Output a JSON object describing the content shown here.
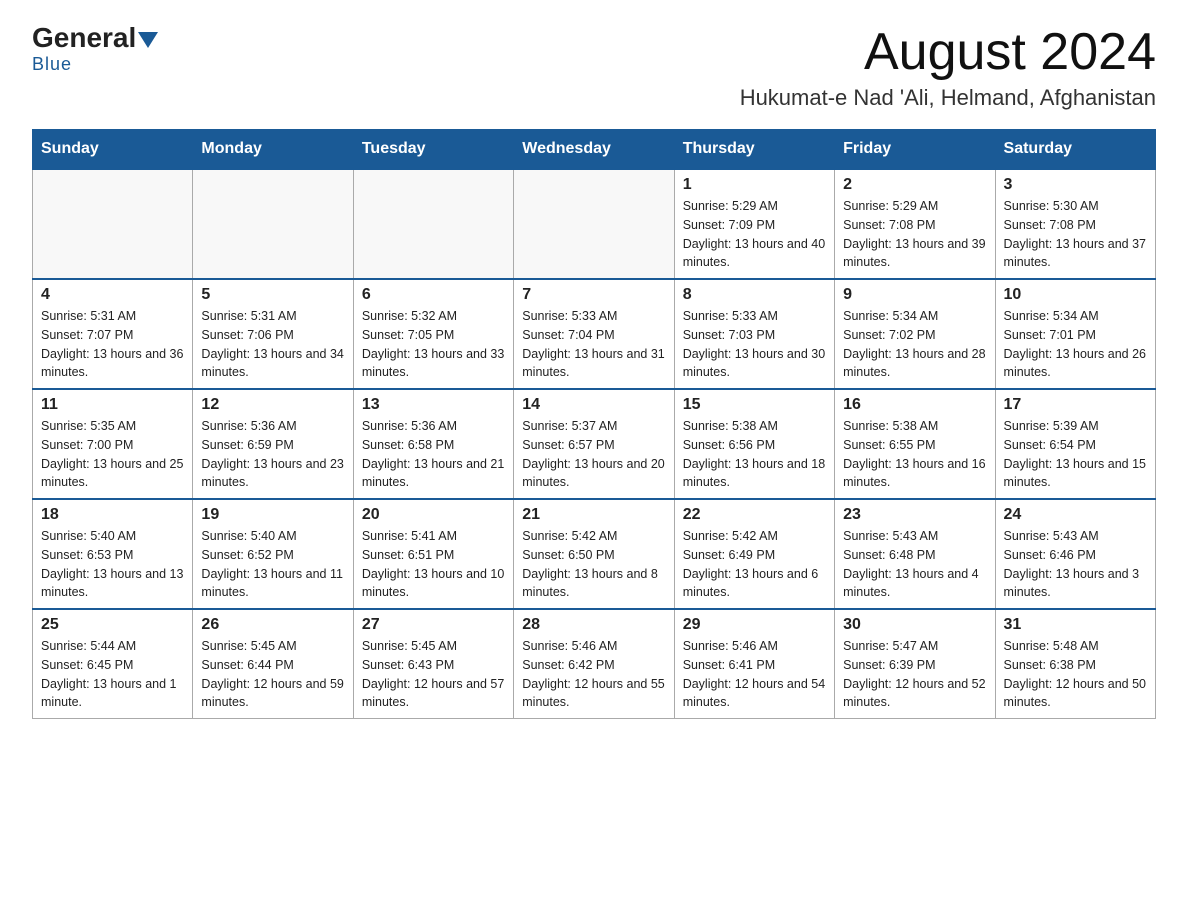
{
  "logo": {
    "general": "General",
    "blue": "Blue"
  },
  "title": "August 2024",
  "subtitle": "Hukumat-e Nad 'Ali, Helmand, Afghanistan",
  "days_of_week": [
    "Sunday",
    "Monday",
    "Tuesday",
    "Wednesday",
    "Thursday",
    "Friday",
    "Saturday"
  ],
  "weeks": [
    [
      {
        "num": "",
        "info": ""
      },
      {
        "num": "",
        "info": ""
      },
      {
        "num": "",
        "info": ""
      },
      {
        "num": "",
        "info": ""
      },
      {
        "num": "1",
        "info": "Sunrise: 5:29 AM\nSunset: 7:09 PM\nDaylight: 13 hours and 40 minutes."
      },
      {
        "num": "2",
        "info": "Sunrise: 5:29 AM\nSunset: 7:08 PM\nDaylight: 13 hours and 39 minutes."
      },
      {
        "num": "3",
        "info": "Sunrise: 5:30 AM\nSunset: 7:08 PM\nDaylight: 13 hours and 37 minutes."
      }
    ],
    [
      {
        "num": "4",
        "info": "Sunrise: 5:31 AM\nSunset: 7:07 PM\nDaylight: 13 hours and 36 minutes."
      },
      {
        "num": "5",
        "info": "Sunrise: 5:31 AM\nSunset: 7:06 PM\nDaylight: 13 hours and 34 minutes."
      },
      {
        "num": "6",
        "info": "Sunrise: 5:32 AM\nSunset: 7:05 PM\nDaylight: 13 hours and 33 minutes."
      },
      {
        "num": "7",
        "info": "Sunrise: 5:33 AM\nSunset: 7:04 PM\nDaylight: 13 hours and 31 minutes."
      },
      {
        "num": "8",
        "info": "Sunrise: 5:33 AM\nSunset: 7:03 PM\nDaylight: 13 hours and 30 minutes."
      },
      {
        "num": "9",
        "info": "Sunrise: 5:34 AM\nSunset: 7:02 PM\nDaylight: 13 hours and 28 minutes."
      },
      {
        "num": "10",
        "info": "Sunrise: 5:34 AM\nSunset: 7:01 PM\nDaylight: 13 hours and 26 minutes."
      }
    ],
    [
      {
        "num": "11",
        "info": "Sunrise: 5:35 AM\nSunset: 7:00 PM\nDaylight: 13 hours and 25 minutes."
      },
      {
        "num": "12",
        "info": "Sunrise: 5:36 AM\nSunset: 6:59 PM\nDaylight: 13 hours and 23 minutes."
      },
      {
        "num": "13",
        "info": "Sunrise: 5:36 AM\nSunset: 6:58 PM\nDaylight: 13 hours and 21 minutes."
      },
      {
        "num": "14",
        "info": "Sunrise: 5:37 AM\nSunset: 6:57 PM\nDaylight: 13 hours and 20 minutes."
      },
      {
        "num": "15",
        "info": "Sunrise: 5:38 AM\nSunset: 6:56 PM\nDaylight: 13 hours and 18 minutes."
      },
      {
        "num": "16",
        "info": "Sunrise: 5:38 AM\nSunset: 6:55 PM\nDaylight: 13 hours and 16 minutes."
      },
      {
        "num": "17",
        "info": "Sunrise: 5:39 AM\nSunset: 6:54 PM\nDaylight: 13 hours and 15 minutes."
      }
    ],
    [
      {
        "num": "18",
        "info": "Sunrise: 5:40 AM\nSunset: 6:53 PM\nDaylight: 13 hours and 13 minutes."
      },
      {
        "num": "19",
        "info": "Sunrise: 5:40 AM\nSunset: 6:52 PM\nDaylight: 13 hours and 11 minutes."
      },
      {
        "num": "20",
        "info": "Sunrise: 5:41 AM\nSunset: 6:51 PM\nDaylight: 13 hours and 10 minutes."
      },
      {
        "num": "21",
        "info": "Sunrise: 5:42 AM\nSunset: 6:50 PM\nDaylight: 13 hours and 8 minutes."
      },
      {
        "num": "22",
        "info": "Sunrise: 5:42 AM\nSunset: 6:49 PM\nDaylight: 13 hours and 6 minutes."
      },
      {
        "num": "23",
        "info": "Sunrise: 5:43 AM\nSunset: 6:48 PM\nDaylight: 13 hours and 4 minutes."
      },
      {
        "num": "24",
        "info": "Sunrise: 5:43 AM\nSunset: 6:46 PM\nDaylight: 13 hours and 3 minutes."
      }
    ],
    [
      {
        "num": "25",
        "info": "Sunrise: 5:44 AM\nSunset: 6:45 PM\nDaylight: 13 hours and 1 minute."
      },
      {
        "num": "26",
        "info": "Sunrise: 5:45 AM\nSunset: 6:44 PM\nDaylight: 12 hours and 59 minutes."
      },
      {
        "num": "27",
        "info": "Sunrise: 5:45 AM\nSunset: 6:43 PM\nDaylight: 12 hours and 57 minutes."
      },
      {
        "num": "28",
        "info": "Sunrise: 5:46 AM\nSunset: 6:42 PM\nDaylight: 12 hours and 55 minutes."
      },
      {
        "num": "29",
        "info": "Sunrise: 5:46 AM\nSunset: 6:41 PM\nDaylight: 12 hours and 54 minutes."
      },
      {
        "num": "30",
        "info": "Sunrise: 5:47 AM\nSunset: 6:39 PM\nDaylight: 12 hours and 52 minutes."
      },
      {
        "num": "31",
        "info": "Sunrise: 5:48 AM\nSunset: 6:38 PM\nDaylight: 12 hours and 50 minutes."
      }
    ]
  ]
}
